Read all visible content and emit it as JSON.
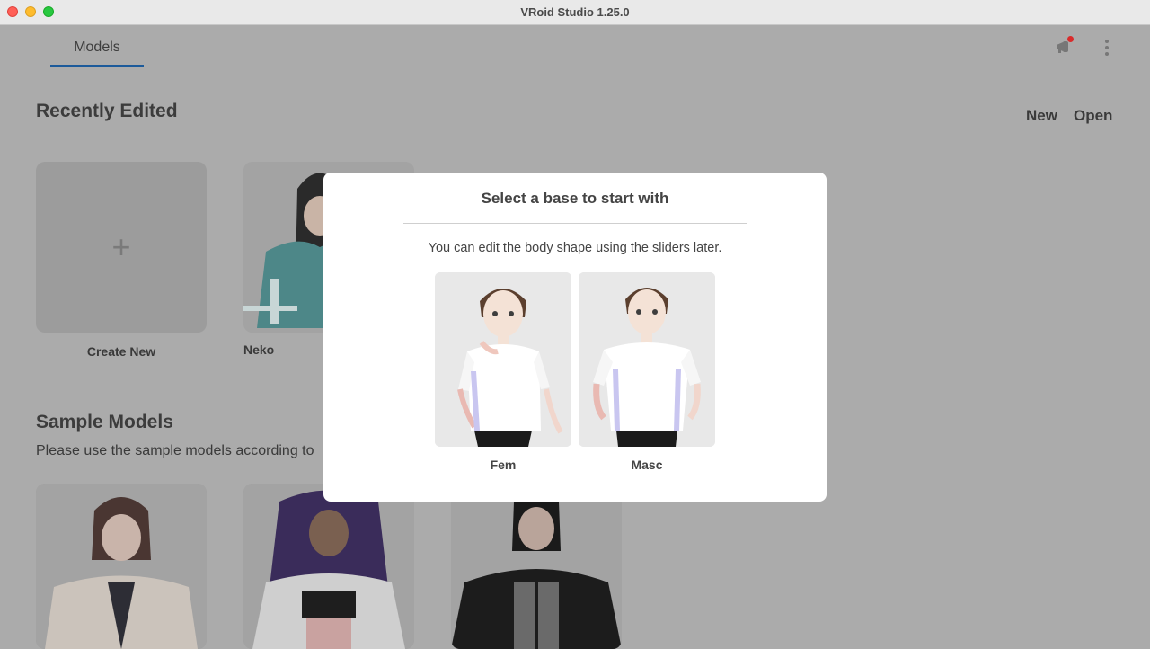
{
  "window": {
    "title": "VRoid Studio 1.25.0"
  },
  "nav": {
    "tab_models": "Models"
  },
  "recent": {
    "title": "Recently Edited",
    "new_label": "New",
    "open_label": "Open",
    "create_plus": "+",
    "create_label": "Create New",
    "items": [
      {
        "label": "Neko"
      }
    ]
  },
  "samples": {
    "title": "Sample Models",
    "description": "Please use the sample models according to"
  },
  "modal": {
    "title": "Select a base to start with",
    "description": "You can edit the body shape using the sliders later.",
    "options": [
      {
        "label": "Fem"
      },
      {
        "label": "Masc"
      }
    ]
  },
  "colors": {
    "accent": "#1c5a9a",
    "overlay": "#ababab",
    "notification": "#d92b2b"
  },
  "icons": {
    "notify": "megaphone-icon",
    "more": "more-vertical-icon",
    "plus": "plus-icon"
  }
}
